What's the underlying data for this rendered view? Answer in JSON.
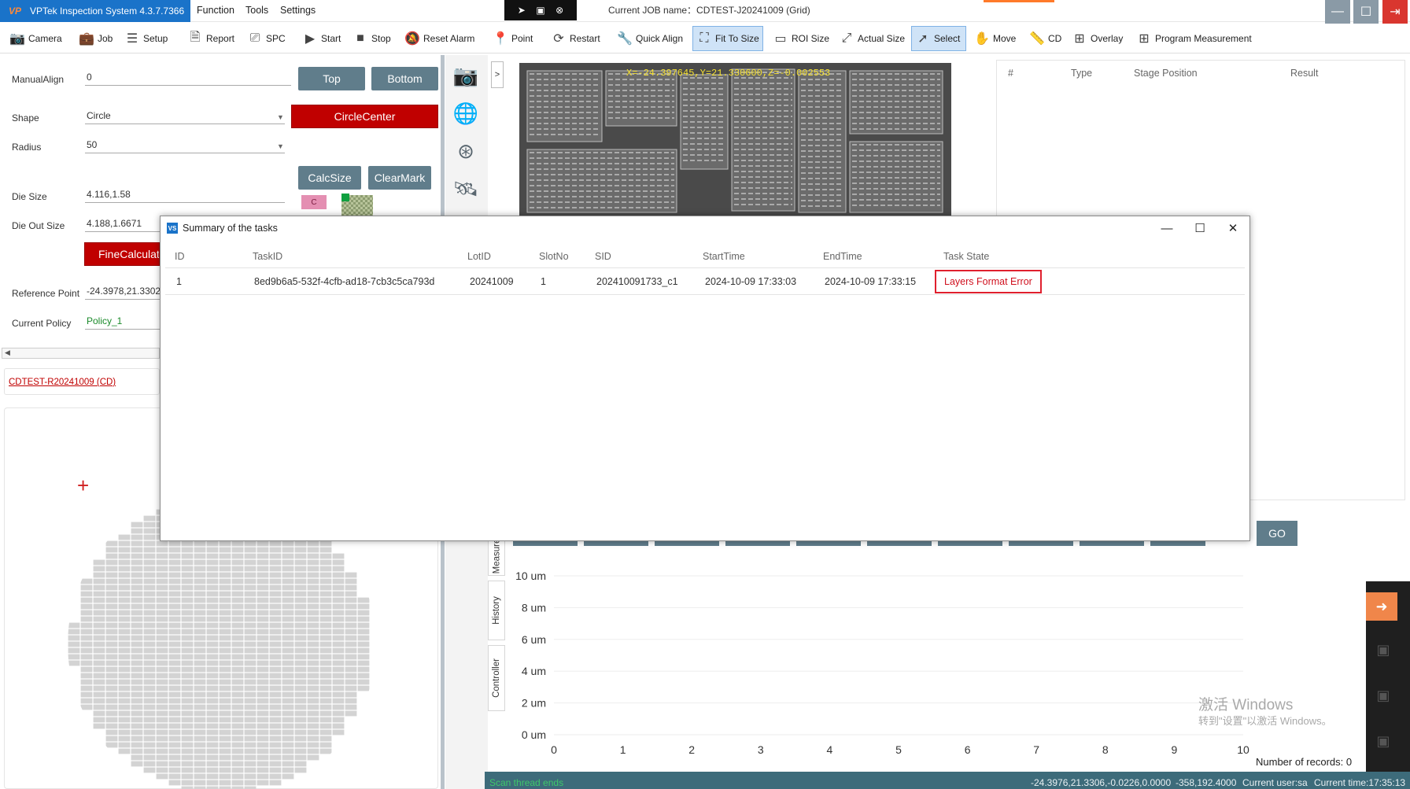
{
  "app": {
    "logo": "VP",
    "title": "VPTek Inspection System 4.3.7.7366",
    "current_job_label": "Current JOB name：CDTEST-J20241009 (Grid)"
  },
  "menu": [
    "Function",
    "Tools",
    "Settings"
  ],
  "toolbar": [
    {
      "label": "Camera",
      "icon": "camera-icon"
    },
    {
      "label": "Job",
      "icon": "briefcase-icon"
    },
    {
      "label": "Setup",
      "icon": "checklist-icon"
    },
    {
      "label": "Report",
      "icon": "document-icon"
    },
    {
      "label": "SPC",
      "icon": "spc-icon"
    },
    {
      "label": "Start",
      "icon": "play-icon"
    },
    {
      "label": "Stop",
      "icon": "stop-icon"
    },
    {
      "label": "Reset Alarm",
      "icon": "bell-off-icon"
    },
    {
      "label": "Point",
      "icon": "pin-icon"
    },
    {
      "label": "Restart",
      "icon": "refresh-icon"
    },
    {
      "label": "Quick Align",
      "icon": "wrench-icon"
    },
    {
      "label": "Fit To Size",
      "icon": "fit-icon"
    },
    {
      "label": "ROI Size",
      "icon": "rectangle-icon"
    },
    {
      "label": "Actual Size",
      "icon": "expand-icon"
    },
    {
      "label": "Select",
      "icon": "cursor-icon"
    },
    {
      "label": "Move",
      "icon": "hand-icon"
    },
    {
      "label": "CD",
      "icon": "ruler-icon"
    },
    {
      "label": "Overlay",
      "icon": "plus-icon"
    },
    {
      "label": "Program Measurement",
      "icon": "plus-icon"
    }
  ],
  "left": {
    "manual_align_label": "ManualAlign",
    "manual_align_value": "0",
    "shape_label": "Shape",
    "shape_value": "Circle",
    "radius_label": "Radius",
    "radius_value": "50",
    "die_size_label": "Die Size",
    "die_size_value": "4.116,1.58",
    "die_out_label": "Die Out Size",
    "die_out_value": "4.188,1.6671",
    "ref_point_label": "Reference Point",
    "ref_point_value": "-24.3978,21.3302,",
    "policy_label": "Current Policy",
    "policy_value": "Policy_1",
    "top_btn": "Top",
    "bottom_btn": "Bottom",
    "circle_center_btn": "CircleCenter",
    "calc_size_btn": "CalcSize",
    "clear_mark_btn": "ClearMark",
    "fine_calc_btn": "FineCalculati",
    "marker_c": "C",
    "recipe_link": "CDTEST-R20241009 (CD)",
    "crosshair": "+"
  },
  "camera": {
    "overlay_text": "X=-24.397645,Y=21.330600,Z=-0.002553",
    "expander": ">"
  },
  "results": {
    "headers": [
      "#",
      "Type",
      "Stage Position",
      "Result"
    ],
    "go": "GO"
  },
  "chart_side_tabs": [
    "Measure",
    "History",
    "Controller"
  ],
  "chart_data": {
    "type": "line",
    "title": "",
    "xlabel": "",
    "ylabel": "",
    "x_ticks": [
      "0",
      "1",
      "2",
      "3",
      "4",
      "5",
      "6",
      "7",
      "8",
      "9",
      "10"
    ],
    "y_ticks": [
      "0 um",
      "2 um",
      "4 um",
      "6 um",
      "8 um",
      "10 um"
    ],
    "xlim": [
      0,
      10
    ],
    "ylim": [
      0,
      10
    ],
    "series": [],
    "grid": true
  },
  "records_label": "Number of records: 0",
  "watermark": {
    "line1": "激活 Windows",
    "line2": "转到\"设置\"以激活 Windows。"
  },
  "status": {
    "left": "Scan thread ends",
    "pos1": "-24.3976,21.3306,-0.0226,0.0000",
    "pos2": "-358,192.4000",
    "user": "Current user:sa",
    "time": "Current time:17:35:13"
  },
  "dialog": {
    "title": "Summary of the tasks",
    "icon_text": "VS",
    "headers": [
      "ID",
      "TaskID",
      "LotID",
      "SlotNo",
      "SID",
      "StartTime",
      "EndTime",
      "Task State"
    ],
    "rows": [
      {
        "id": "1",
        "task_id": "8ed9b6a5-532f-4cfb-ad18-7cb3c5ca793d",
        "lot_id": "20241009",
        "slot_no": "1",
        "sid": "202410091733_c1",
        "start_time": "2024-10-09 17:33:03",
        "end_time": "2024-10-09 17:33:15",
        "state": "Layers Format Error"
      }
    ]
  },
  "colors": {
    "accent": "#1a73c9",
    "danger": "#c00000",
    "button_gray": "#607d8b",
    "status_bar": "#3d6b7a"
  }
}
